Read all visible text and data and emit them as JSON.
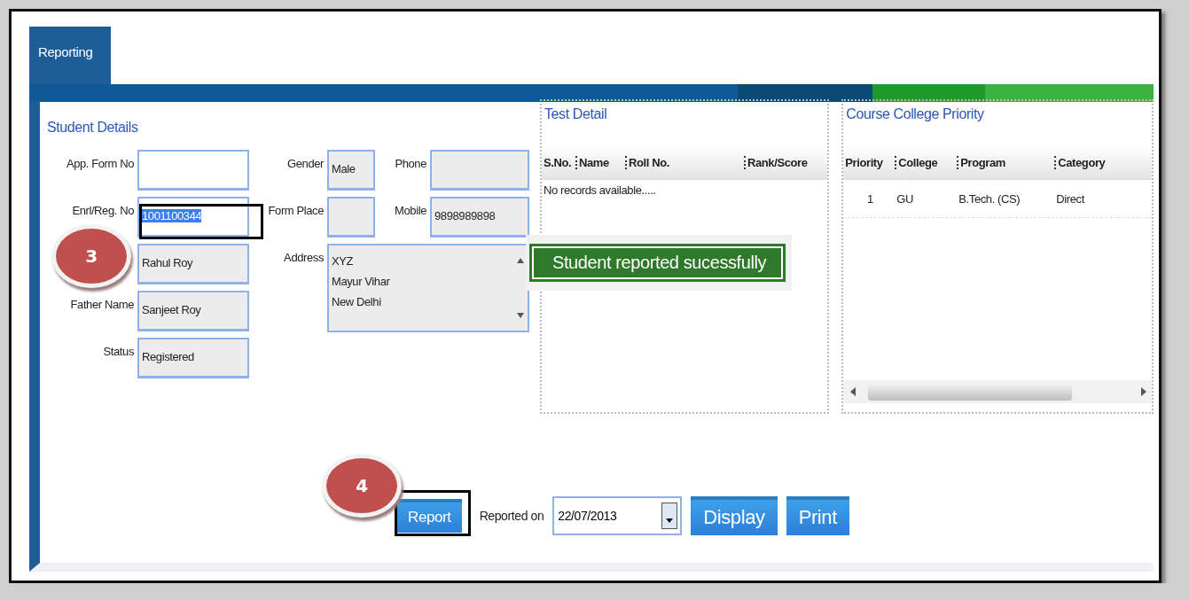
{
  "tab": {
    "label": "Reporting",
    "selected": true
  },
  "student_details": {
    "title": "Student Details",
    "fields": [
      {
        "label": "App. Form No",
        "readonly": false
      },
      {
        "label": "Gender",
        "value": "Male",
        "readonly": true
      },
      {
        "label": "Phone",
        "readonly": true
      },
      {
        "label": "Enrl/Reg. No",
        "value": "1001100344",
        "readonly": false,
        "text_selected": true
      },
      {
        "label": "Form Place",
        "readonly": true
      },
      {
        "label": "Mobile",
        "value": "9898989898",
        "readonly": true
      },
      {
        "value": "Rahul  Roy",
        "readonly": true
      },
      {
        "label": "Father Name",
        "value": "Sanjeet  Roy",
        "readonly": true
      },
      {
        "label": "Status",
        "value": "Registered",
        "readonly": true
      }
    ],
    "address": {
      "label": "Address",
      "lines": [
        "XYZ",
        "Mayur Vihar",
        "New Delhi"
      ]
    }
  },
  "test_detail": {
    "title": "Test Detail",
    "columns": [
      "S.No.",
      "Name",
      "Roll No.",
      "Rank/Score"
    ],
    "empty_message": "No records available....."
  },
  "course_college_priority": {
    "title": "Course College Priority",
    "columns": [
      "Priority",
      "College",
      "Program",
      "Category"
    ],
    "rows": [
      [
        "1",
        "GU",
        "B.Tech. (CS)",
        "Direct"
      ]
    ]
  },
  "actions": {
    "report_button": "Report",
    "reported_on_label": "Reported on",
    "date_value": "22/07/2013",
    "buttons": [
      "Display",
      "Print"
    ]
  },
  "toast": "Student reported sucessfully",
  "step_badges": [
    {
      "label": "3"
    },
    {
      "label": "4"
    }
  ]
}
